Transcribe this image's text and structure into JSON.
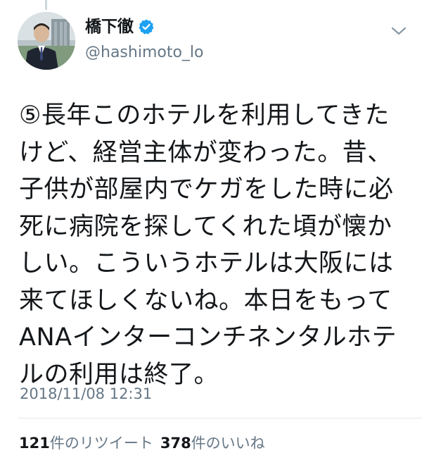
{
  "author": {
    "display_name": "橋下徹",
    "handle": "@hashimoto_lo",
    "verified": true
  },
  "tweet": {
    "text": "⑤長年このホテルを利用してきた\nけど、経営主体が変わった。昔、\n子供が部屋内でケガをした時に必\n死に病院を探してくれた頃が懐か\nしい。こういうホテルは大阪には\n来てほしくないね。本日をもって\nANAインターコンチネンタルホテ\nルの利用は終了。",
    "timestamp": "2018/11/08 12:31"
  },
  "stats": {
    "retweets": {
      "count": "121",
      "label": "件のリツイート"
    },
    "likes": {
      "count": "378",
      "label": "件のいいね"
    }
  },
  "icons": {
    "verified": "verified-badge-icon",
    "menu": "chevron-down-icon"
  },
  "colors": {
    "verified_blue": "#1da1f2",
    "secondary_text": "#657786",
    "primary_text": "#14171a",
    "divider": "#e1e8ed"
  }
}
